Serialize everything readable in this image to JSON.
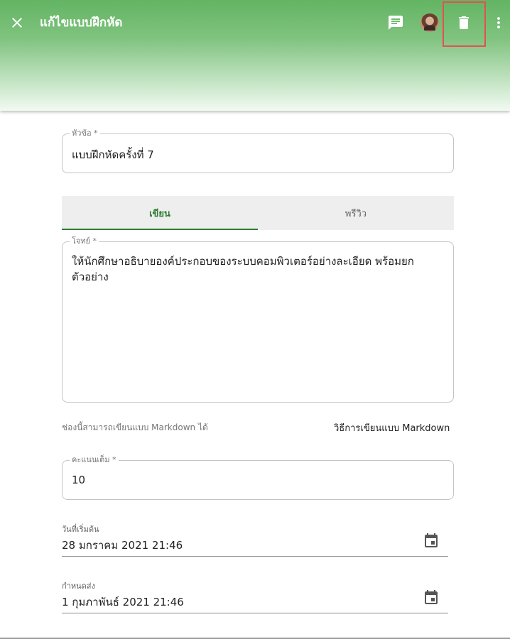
{
  "header": {
    "title": "แก้ไขแบบฝึกหัด",
    "icons": {
      "close": "close-icon",
      "chat": "comment-icon",
      "avatar": "user-avatar",
      "delete": "trash-icon",
      "more": "more-vert-icon"
    },
    "colors": {
      "gradient_top": "#63b463",
      "gradient_bottom": "#f2faf2",
      "highlight": "#e35151"
    }
  },
  "form": {
    "title_field": {
      "label": "หัวข้อ *",
      "value": "แบบฝึกหัดครั้งที่ 7"
    },
    "tabs": [
      {
        "label": "เขียน",
        "active": true
      },
      {
        "label": "พรีวิว",
        "active": false
      }
    ],
    "question_field": {
      "label": "โจทย์ *",
      "value": "ให้นักศึกษาอธิบายองค์ประกอบของระบบคอมพิวเตอร์อย่างละเอียด พร้อมยกตัวอย่าง"
    },
    "markdown_hint": "ช่องนี้สามารถเขียนแบบ Markdown ได้",
    "markdown_link": "วิธีการเขียนแบบ Markdown",
    "score_field": {
      "label": "คะแนนเต็ม *",
      "value": "10"
    },
    "start_date": {
      "label": "วันที่เริ่มต้น",
      "value": "28 มกราคม 2021 21:46"
    },
    "due_date": {
      "label": "กำหนดส่ง",
      "value": "1 กุมภาพันธ์ 2021 21:46"
    },
    "accent_color": "#2e7d32"
  }
}
